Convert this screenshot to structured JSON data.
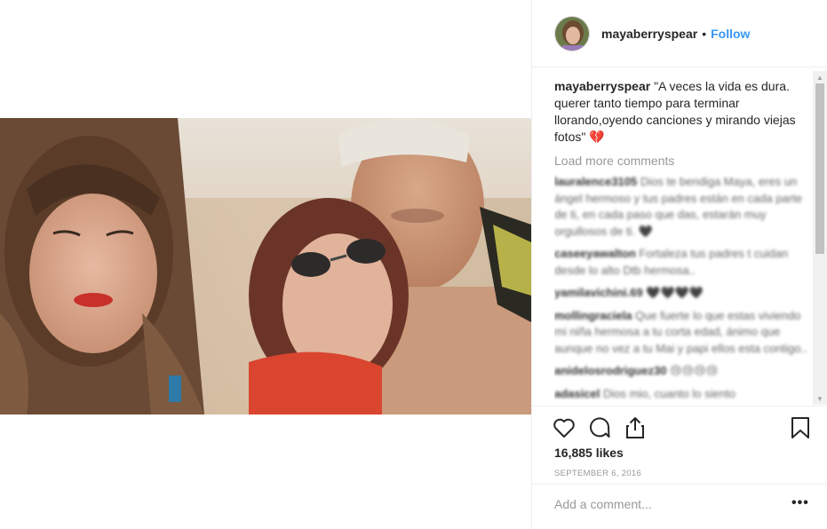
{
  "post": {
    "username": "mayaberryspear",
    "follow_label": "Follow",
    "separator": "•",
    "caption_user": "mayaberryspear",
    "caption_text": "\"A veces la vida es dura. querer tanto tiempo para terminar llorando,oyendo canciones y mirando viejas fotos\" 💔",
    "load_more": "Load more comments",
    "comments": [
      {
        "user": "lauralence3105",
        "text": "Dios te bendiga Maya, eres un ángel hermoso y tus padres están en cada parte de ti, en cada paso que das, estarán muy orgullosos de ti. 🖤"
      },
      {
        "user": "caseeyawalton",
        "text": "Fortaleza tus padres t cuidan desde lo alto Dtb hermosa.."
      },
      {
        "user": "yamilavichini.69",
        "text": "🖤🖤🖤🖤"
      },
      {
        "user": "mollingraciela",
        "text": "Que fuerte lo que estas viviendo mi niña hermosa a tu corta edad, ánimo que aunque no vez a tu Mai y papi ellos esta contigo.."
      },
      {
        "user": "anidelosrodriguez30",
        "text": "😢😢😢😢"
      },
      {
        "user": "adasicel",
        "text": "Dios mio, cuanto lo siento"
      }
    ],
    "likes": "16,885 likes",
    "date": "SEPTEMBER 6, 2016",
    "add_comment_placeholder": "Add a comment...",
    "more_label": "•••",
    "icons": [
      "heart-icon",
      "comment-icon",
      "share-icon",
      "bookmark-icon",
      "ellipsis-icon"
    ]
  }
}
